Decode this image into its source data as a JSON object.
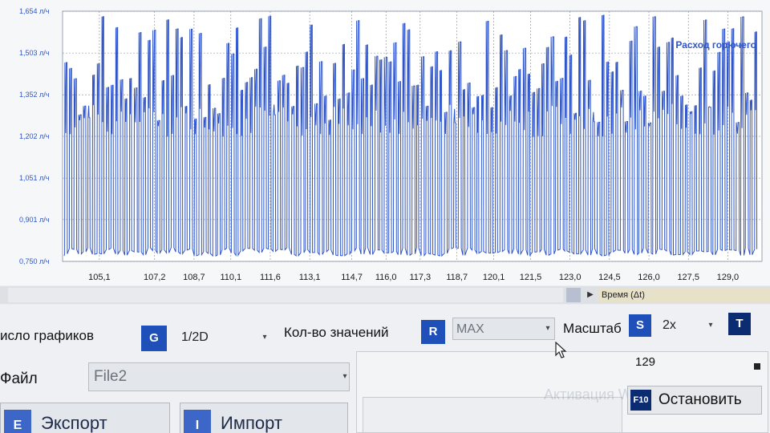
{
  "chart_data": {
    "type": "line",
    "title": "",
    "series": [
      {
        "name": "Расход горючего"
      }
    ],
    "y_ticks": [
      "1,654 л/ч",
      "1,503 л/ч",
      "1,352 л/ч",
      "1,202 л/ч",
      "1,051 л/ч",
      "0,901 л/ч",
      "0,750 л/ч"
    ],
    "y_values": [
      1.654,
      1.503,
      1.352,
      1.202,
      1.051,
      0.901,
      0.75
    ],
    "ylim": [
      0.75,
      1.654
    ],
    "x_ticks": [
      "105,1",
      "107,2",
      "108,7",
      "110,1",
      "111,6",
      "113,1",
      "114,7",
      "116,0",
      "117,3",
      "118,7",
      "120,1",
      "121,5",
      "123,0",
      "124,5",
      "126,0",
      "127,5",
      "129,0"
    ],
    "x_values": [
      105.1,
      107.2,
      108.7,
      110.1,
      111.6,
      113.1,
      114.7,
      116.0,
      117.3,
      118.7,
      120.1,
      121.5,
      123.0,
      124.5,
      126.0,
      127.5,
      129.0
    ],
    "xlim": [
      103.7,
      130.3
    ],
    "xlabel": "Время (Δt)",
    "grid": true,
    "line_color": "#2f55c8",
    "signal": {
      "kind": "pulse-train",
      "low": 0.77,
      "high_min": 1.25,
      "high_max": 1.64,
      "pulses": 150
    }
  },
  "colors": {
    "accent": "#1f4fb8",
    "dark_key": "#0c2c72"
  },
  "controls": {
    "graph_count": {
      "label": "исло графиков",
      "key": "G",
      "value": "1/2D"
    },
    "value_count": {
      "label": "Кол-во значений",
      "key": "R",
      "value": "MAX"
    },
    "scale": {
      "label": "Масштаб",
      "key": "S",
      "value": "2x",
      "extra_key": "T"
    },
    "file": {
      "label": "Файл",
      "value": "File2"
    },
    "export_button": {
      "key": "E",
      "label": "Экспорт"
    },
    "import_button": {
      "key": "I",
      "label": "Импорт"
    },
    "counter": "129",
    "stop_button": {
      "key": "F10",
      "label": "Остановить"
    },
    "watermark": "Активация Windows"
  },
  "icons": {
    "cursor": "mouse-pointer-icon",
    "scroll_right": "chevron-right-icon",
    "dropdown": "chevron-down-icon",
    "stop": "stop-square-icon"
  }
}
